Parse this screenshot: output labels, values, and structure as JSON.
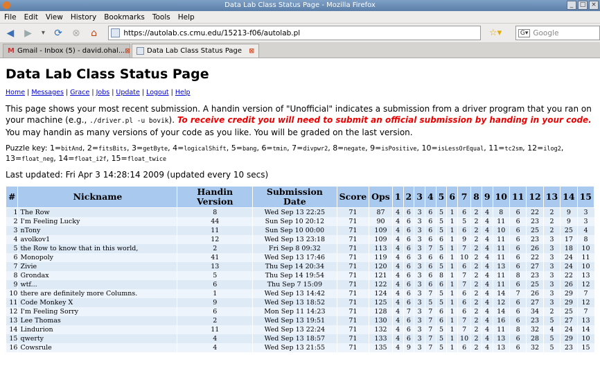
{
  "window_title": "Data Lab Class Status Page - Mozilla Firefox",
  "menu": [
    "File",
    "Edit",
    "View",
    "History",
    "Bookmarks",
    "Tools",
    "Help"
  ],
  "url": "https://autolab.cs.cmu.edu/15213-f06/autolab.pl",
  "search_placeholder": "Google",
  "tabs": [
    {
      "label": "Gmail - Inbox (5) - david.ohal..."
    },
    {
      "label": "Data Lab Class Status Page"
    }
  ],
  "page": {
    "title": "Data Lab Class Status Page",
    "links": [
      "Home",
      "Messages",
      "Grace",
      "Jobs",
      "Update",
      "Logout",
      "Help"
    ],
    "intro1": "This page shows your most recent submission. A handin version of \"Unofficial\" indicates a submission from a driver program that you ran on your machine (e.g., ",
    "intro_cmd": "./driver.pl -u bovik",
    "intro2": "). ",
    "intro_red": "To receive credit you will need to submit an official submission by handing in your code.",
    "intro3": " You may handin as many versions of your code as you like. You will be graded on the last version.",
    "puzzle_label": "Puzzle key: ",
    "puzzles": [
      [
        "1",
        "bitAnd"
      ],
      [
        "2",
        "fitsBits"
      ],
      [
        "3",
        "getByte"
      ],
      [
        "4",
        "logicalShift"
      ],
      [
        "5",
        "bang"
      ],
      [
        "6",
        "tmin"
      ],
      [
        "7",
        "divpwr2"
      ],
      [
        "8",
        "negate"
      ],
      [
        "9",
        "isPositive"
      ],
      [
        "10",
        "isLessOrEqual"
      ],
      [
        "11",
        "tc2sm"
      ],
      [
        "12",
        "ilog2"
      ],
      [
        "13",
        "float_neg"
      ],
      [
        "14",
        "float_i2f"
      ],
      [
        "15",
        "float_twice"
      ]
    ],
    "updated": "Last updated: Fri Apr 3 14:28:14 2009 (updated every 10 secs)"
  },
  "table": {
    "headers": [
      "#",
      "Nickname",
      "Handin Version",
      "Submission Date",
      "Score",
      "Ops",
      "1",
      "2",
      "3",
      "4",
      "5",
      "6",
      "7",
      "8",
      "9",
      "10",
      "11",
      "12",
      "13",
      "14",
      "15"
    ],
    "rows": [
      [
        "1",
        "The Row",
        "8",
        "Wed Sep 13 22:25",
        "71",
        "87",
        "4",
        "6",
        "3",
        "6",
        "5",
        "1",
        "6",
        "2",
        "4",
        "8",
        "6",
        "22",
        "2",
        "9",
        "3"
      ],
      [
        "2",
        "I'm Feeling Lucky",
        "44",
        "Sun Sep 10 20:12",
        "71",
        "90",
        "4",
        "6",
        "3",
        "6",
        "5",
        "1",
        "5",
        "2",
        "4",
        "11",
        "6",
        "23",
        "2",
        "9",
        "3"
      ],
      [
        "3",
        "nTony",
        "11",
        "Sun Sep 10 00:00",
        "71",
        "109",
        "4",
        "6",
        "3",
        "6",
        "5",
        "1",
        "6",
        "2",
        "4",
        "10",
        "6",
        "25",
        "2",
        "25",
        "4"
      ],
      [
        "4",
        "avolkov1",
        "12",
        "Wed Sep 13 23:18",
        "71",
        "109",
        "4",
        "6",
        "3",
        "6",
        "6",
        "1",
        "9",
        "2",
        "4",
        "11",
        "6",
        "23",
        "3",
        "17",
        "8"
      ],
      [
        "5",
        "the Row to know that in this world,",
        "2",
        "Fri Sep 8 09:32",
        "71",
        "113",
        "4",
        "6",
        "3",
        "7",
        "5",
        "1",
        "7",
        "2",
        "4",
        "11",
        "6",
        "26",
        "3",
        "18",
        "10"
      ],
      [
        "6",
        "Monopoly",
        "41",
        "Wed Sep 13 17:46",
        "71",
        "119",
        "4",
        "6",
        "3",
        "6",
        "6",
        "1",
        "10",
        "2",
        "4",
        "11",
        "6",
        "22",
        "3",
        "24",
        "11"
      ],
      [
        "7",
        "Zivie",
        "13",
        "Thu Sep 14 20:34",
        "71",
        "120",
        "4",
        "6",
        "3",
        "6",
        "5",
        "1",
        "6",
        "2",
        "4",
        "13",
        "6",
        "27",
        "3",
        "24",
        "10"
      ],
      [
        "8",
        "Grondax",
        "5",
        "Thu Sep 14 19:54",
        "71",
        "121",
        "4",
        "6",
        "3",
        "6",
        "8",
        "1",
        "7",
        "2",
        "4",
        "11",
        "8",
        "23",
        "3",
        "22",
        "13"
      ],
      [
        "9",
        "wtf...",
        "6",
        "Thu Sep 7 15:09",
        "71",
        "122",
        "4",
        "6",
        "3",
        "6",
        "6",
        "1",
        "7",
        "2",
        "4",
        "11",
        "6",
        "25",
        "3",
        "26",
        "12"
      ],
      [
        "10",
        "there are definitely more Columns.",
        "1",
        "Wed Sep 13 14:42",
        "71",
        "124",
        "4",
        "6",
        "3",
        "7",
        "5",
        "1",
        "6",
        "2",
        "4",
        "14",
        "7",
        "26",
        "3",
        "29",
        "7"
      ],
      [
        "11",
        "Code Monkey X",
        "9",
        "Wed Sep 13 18:52",
        "71",
        "125",
        "4",
        "6",
        "3",
        "5",
        "5",
        "1",
        "6",
        "2",
        "4",
        "12",
        "6",
        "27",
        "3",
        "29",
        "12"
      ],
      [
        "12",
        "I'm Feeling Sorry",
        "6",
        "Mon Sep 11 14:23",
        "71",
        "128",
        "4",
        "7",
        "3",
        "7",
        "6",
        "1",
        "6",
        "2",
        "4",
        "14",
        "6",
        "34",
        "2",
        "25",
        "7"
      ],
      [
        "13",
        "Lee Thomas",
        "2",
        "Wed Sep 13 19:51",
        "71",
        "130",
        "4",
        "6",
        "3",
        "7",
        "6",
        "1",
        "7",
        "2",
        "4",
        "16",
        "6",
        "23",
        "5",
        "27",
        "13"
      ],
      [
        "14",
        "Lindurion",
        "11",
        "Wed Sep 13 22:24",
        "71",
        "132",
        "4",
        "6",
        "3",
        "7",
        "5",
        "1",
        "7",
        "2",
        "4",
        "11",
        "8",
        "32",
        "4",
        "24",
        "14"
      ],
      [
        "15",
        "qwerty",
        "4",
        "Wed Sep 13 18:57",
        "71",
        "133",
        "4",
        "6",
        "3",
        "7",
        "5",
        "1",
        "10",
        "2",
        "4",
        "13",
        "6",
        "28",
        "5",
        "29",
        "10"
      ],
      [
        "16",
        "Cowsrule",
        "4",
        "Wed Sep 13 21:55",
        "71",
        "135",
        "4",
        "9",
        "3",
        "7",
        "5",
        "1",
        "6",
        "2",
        "4",
        "13",
        "6",
        "32",
        "5",
        "23",
        "15"
      ]
    ]
  }
}
